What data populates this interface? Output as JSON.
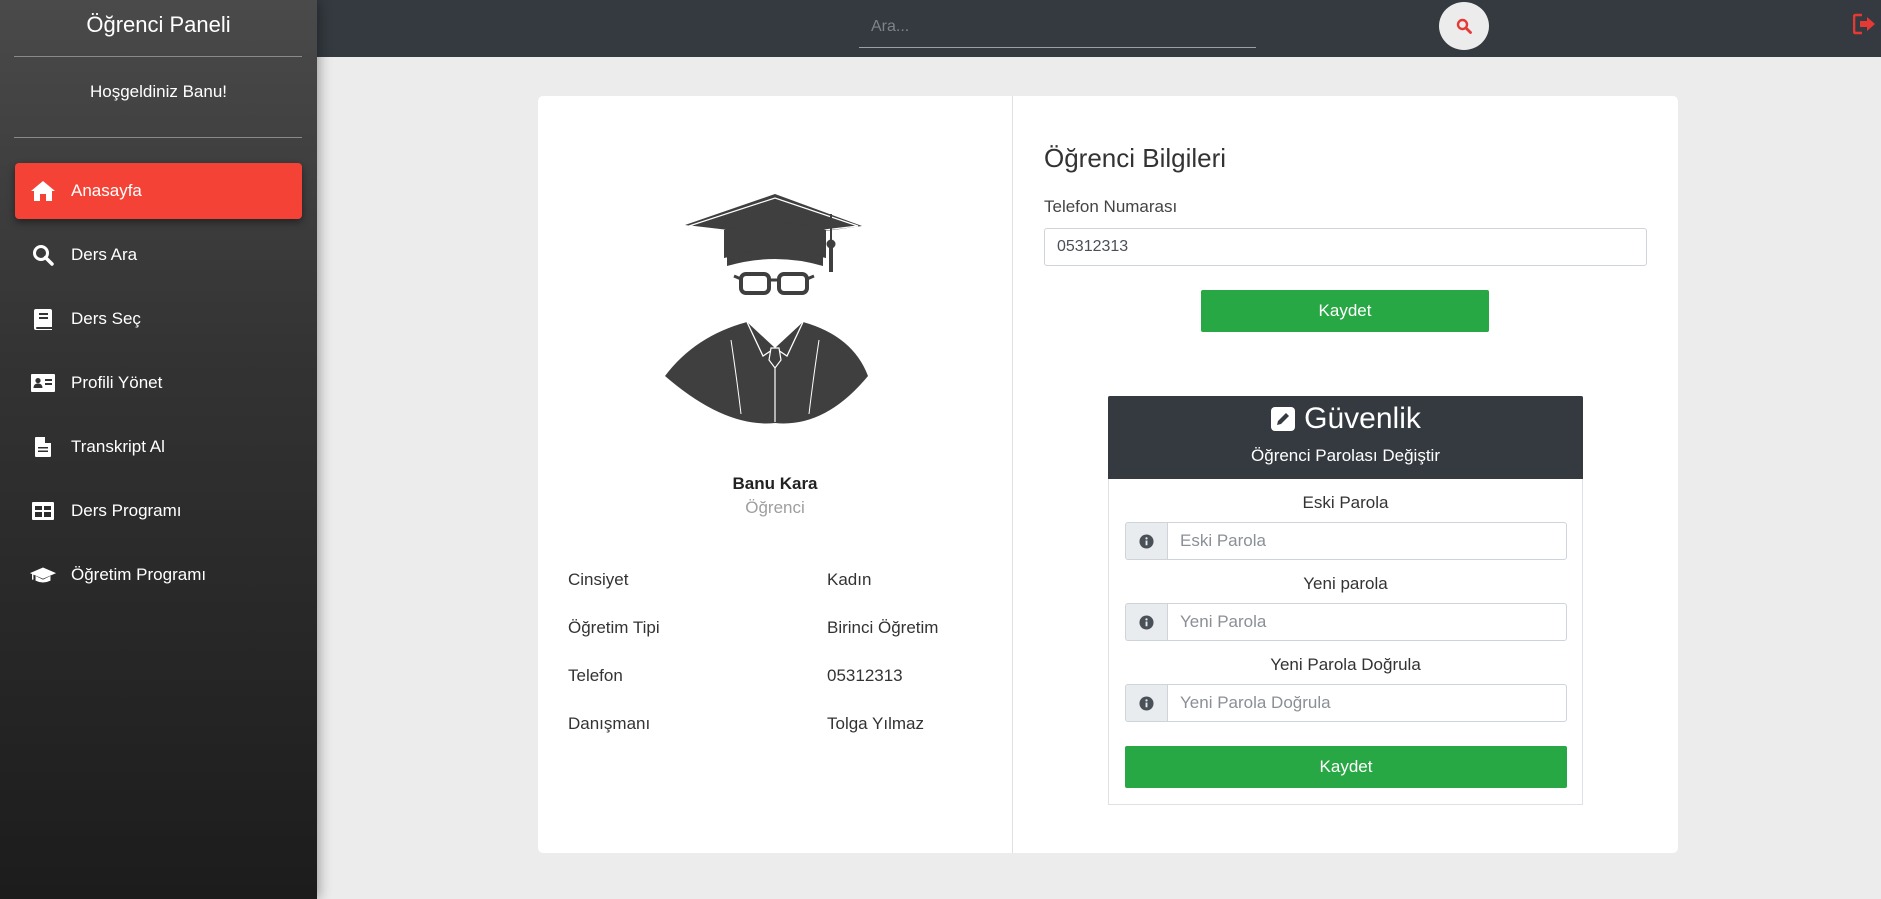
{
  "sidebar": {
    "title": "Öğrenci Paneli",
    "welcome": "Hoşgeldiniz Banu!",
    "items": [
      {
        "label": "Anasayfa",
        "icon": "home-icon"
      },
      {
        "label": "Ders Ara",
        "icon": "search-icon"
      },
      {
        "label": "Ders Seç",
        "icon": "book-icon"
      },
      {
        "label": "Profili Yönet",
        "icon": "id-card-icon"
      },
      {
        "label": "Transkript Al",
        "icon": "file-icon"
      },
      {
        "label": "Ders Programı",
        "icon": "table-icon"
      },
      {
        "label": "Öğretim Programı",
        "icon": "graduation-cap-icon"
      }
    ],
    "active_index": 0
  },
  "topbar": {
    "search_placeholder": "Ara..."
  },
  "profile": {
    "name": "Banu Kara",
    "role": "Öğrenci",
    "info": [
      {
        "key": "Cinsiyet",
        "value": "Kadın"
      },
      {
        "key": "Öğretim Tipi",
        "value": "Birinci Öğretim"
      },
      {
        "key": "Telefon",
        "value": "05312313"
      },
      {
        "key": "Danışmanı",
        "value": "Tolga Yılmaz"
      }
    ]
  },
  "student_info": {
    "title": "Öğrenci Bilgileri",
    "phone_label": "Telefon Numarası",
    "phone_value": "05312313",
    "save_label": "Kaydet"
  },
  "security": {
    "title": "Güvenlik",
    "subtitle": "Öğrenci Parolası Değiştir",
    "old_label": "Eski Parola",
    "old_placeholder": "Eski Parola",
    "new_label": "Yeni parola",
    "new_placeholder": "Yeni Parola",
    "confirm_label": "Yeni Parola Doğrula",
    "confirm_placeholder": "Yeni Parola Doğrula",
    "save_label": "Kaydet"
  },
  "colors": {
    "accent": "#f44336",
    "success": "#28a745",
    "dark": "#343a40",
    "logout": "#e53935"
  }
}
